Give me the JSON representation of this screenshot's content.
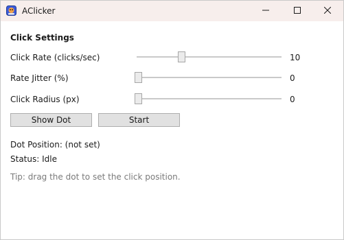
{
  "window": {
    "title": "AClicker",
    "icon": "app-logo-icon",
    "controls": [
      "minimize-icon",
      "maximize-icon",
      "close-icon"
    ]
  },
  "settings": {
    "section_title": "Click Settings",
    "click_rate": {
      "label": "Click Rate (clicks/sec)",
      "value": "10"
    },
    "rate_jitter": {
      "label": "Rate Jitter (%)",
      "value": "0"
    },
    "click_radius": {
      "label": "Click Radius (px)",
      "value": "0"
    }
  },
  "buttons": {
    "show_dot": "Show Dot",
    "start": "Start"
  },
  "status": {
    "dot_position": "Dot Position: (not set)",
    "status": "Status: Idle",
    "tip": "Tip: drag the dot to set the click position."
  },
  "colors": {
    "titlebar": "#f7eeec",
    "button_bg": "#e1e1e1",
    "tip_text": "#7a7a7a"
  }
}
